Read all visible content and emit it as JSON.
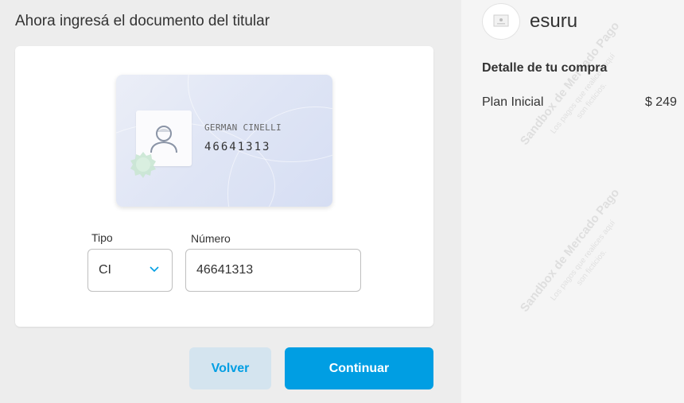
{
  "page": {
    "title": "Ahora ingresá el documento del titular"
  },
  "id_card": {
    "holder_name": "GERMAN CINELLI",
    "document_number": "46641313"
  },
  "form": {
    "type_label": "Tipo",
    "type_value": "CI",
    "number_label": "Número",
    "number_value": "46641313"
  },
  "actions": {
    "back_label": "Volver",
    "continue_label": "Continuar"
  },
  "summary": {
    "store_name": "esuru",
    "detail_title": "Detalle de tu compra",
    "items": [
      {
        "name": "Plan Inicial",
        "price": "$ 249"
      }
    ]
  },
  "watermark": {
    "main": "Sandbox de Mercado Pago",
    "sub_line1": "Los pagos que realices aquí",
    "sub_line2": "son ficticios."
  },
  "colors": {
    "accent": "#009ee3",
    "secondary_button_bg": "#d4e4ef",
    "page_bg": "#ededed",
    "sidebar_bg": "#f5f5f5"
  },
  "icons": {
    "avatar": "person-silhouette-icon",
    "select_arrow": "chevron-down-icon",
    "store": "store-logo-icon",
    "seal": "seal-icon"
  }
}
